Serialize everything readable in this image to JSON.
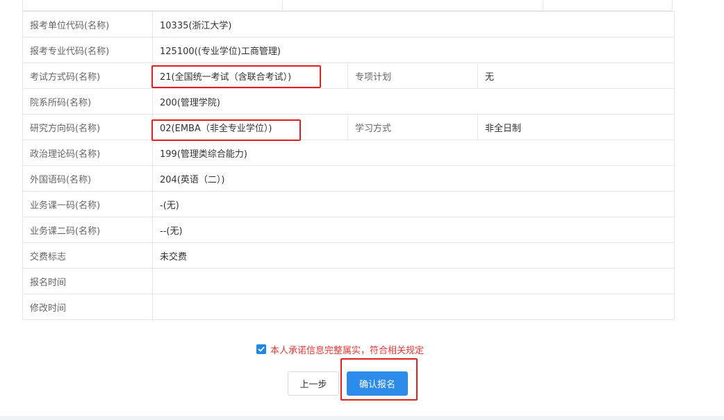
{
  "rows": [
    {
      "label": "报考单位代码(名称)",
      "value": "10335(浙江大学)"
    },
    {
      "label": "报考专业代码(名称)",
      "value": "125100((专业学位)工商管理)"
    },
    {
      "label": "考试方式码(名称)",
      "value": "21(全国统一考试（含联合考试）)",
      "extra_label": "专项计划",
      "extra_value": "无"
    },
    {
      "label": "院系所码(名称)",
      "value": "200(管理学院)"
    },
    {
      "label": "研究方向码(名称)",
      "value": "02(EMBA（非全专业学位）)",
      "extra_label": "学习方式",
      "extra_value": "非全日制"
    },
    {
      "label": "政治理论码(名称)",
      "value": "199(管理类综合能力)"
    },
    {
      "label": "外国语码(名称)",
      "value": "204(英语（二）)"
    },
    {
      "label": "业务课一码(名称)",
      "value": "-(无)"
    },
    {
      "label": "业务课二码(名称)",
      "value": "--(无)"
    },
    {
      "label": "交费标志",
      "value": "未交费"
    },
    {
      "label": "报名时间",
      "value": ""
    },
    {
      "label": "修改时间",
      "value": ""
    }
  ],
  "promise": {
    "checked": true,
    "text": "本人承诺信息完整属实，符合相关规定"
  },
  "buttons": {
    "prev_label": "上一步",
    "confirm_label": "确认报名"
  },
  "colors": {
    "accent": "#2d8ceb",
    "warning_text": "#e53935",
    "highlight_box": "#e02020"
  }
}
